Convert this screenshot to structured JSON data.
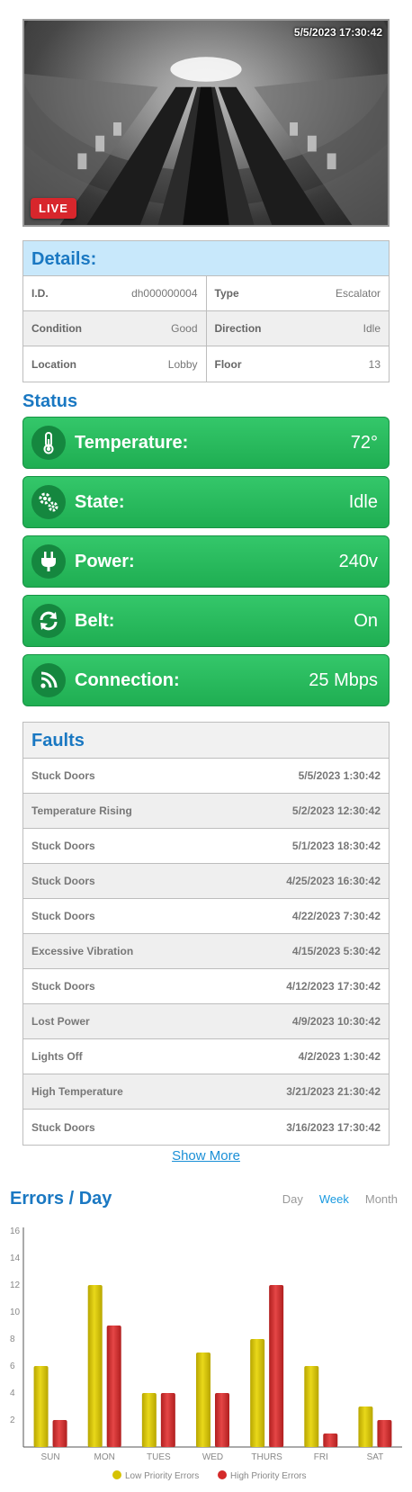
{
  "camera": {
    "timestamp": "5/5/2023 17:30:42",
    "live_label": "LIVE"
  },
  "details": {
    "title": "Details:",
    "rows": [
      [
        {
          "label": "I.D.",
          "value": "dh000000004"
        },
        {
          "label": "Type",
          "value": "Escalator"
        }
      ],
      [
        {
          "label": "Condition",
          "value": "Good"
        },
        {
          "label": "Direction",
          "value": "Idle"
        }
      ],
      [
        {
          "label": "Location",
          "value": "Lobby"
        },
        {
          "label": "Floor",
          "value": "13"
        }
      ]
    ]
  },
  "status": {
    "title": "Status",
    "color": "#1fae52",
    "items": [
      {
        "label": "Temperature:",
        "value": "72°",
        "icon": "thermometer-icon"
      },
      {
        "label": "State:",
        "value": "Idle",
        "icon": "gears-icon"
      },
      {
        "label": "Power:",
        "value": "240v",
        "icon": "plug-icon"
      },
      {
        "label": "Belt:",
        "value": "On",
        "icon": "sync-icon"
      },
      {
        "label": "Connection:",
        "value": "25 Mbps",
        "icon": "signal-icon"
      }
    ]
  },
  "faults": {
    "title": "Faults",
    "rows": [
      {
        "name": "Stuck Doors",
        "time": "5/5/2023  1:30:42"
      },
      {
        "name": "Temperature Rising",
        "time": "5/2/2023  12:30:42"
      },
      {
        "name": "Stuck Doors",
        "time": "5/1/2023  18:30:42"
      },
      {
        "name": "Stuck Doors",
        "time": "4/25/2023  16:30:42"
      },
      {
        "name": "Stuck Doors",
        "time": "4/22/2023  7:30:42"
      },
      {
        "name": "Excessive Vibration",
        "time": "4/15/2023  5:30:42"
      },
      {
        "name": "Stuck Doors",
        "time": "4/12/2023  17:30:42"
      },
      {
        "name": "Lost Power",
        "time": "4/9/2023  10:30:42"
      },
      {
        "name": "Lights Off",
        "time": "4/2/2023  1:30:42"
      },
      {
        "name": "High Temperature",
        "time": "3/21/2023  21:30:42"
      },
      {
        "name": "Stuck Doors",
        "time": "3/16/2023  17:30:42"
      }
    ],
    "show_more_label": "Show More"
  },
  "errors_chart": {
    "title": "Errors / Day",
    "tabs": [
      "Day",
      "Week",
      "Month"
    ],
    "active_tab": "Week"
  },
  "chart_data": {
    "type": "bar",
    "title": "Errors / Day",
    "categories": [
      "SUN",
      "MON",
      "TUES",
      "WED",
      "THURS",
      "FRI",
      "SAT"
    ],
    "series": [
      {
        "name": "Low Priority Errors",
        "color": "#d6c200",
        "values": [
          6,
          12,
          4,
          7,
          8,
          6,
          3
        ]
      },
      {
        "name": "High Priority Errors",
        "color": "#d42a2a",
        "values": [
          2,
          9,
          4,
          4,
          12,
          1,
          2
        ]
      }
    ],
    "ylim": [
      0,
      16
    ],
    "yticks": [
      2,
      4,
      6,
      8,
      10,
      12,
      14,
      16
    ],
    "grid": false,
    "legend_position": "bottom"
  }
}
